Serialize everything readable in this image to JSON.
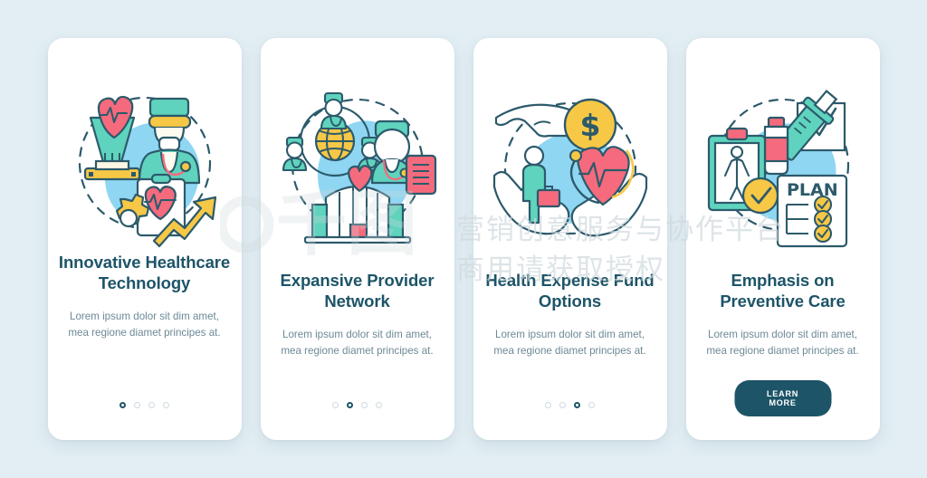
{
  "page": {
    "background_color": "#e2eef3",
    "card_color": "#ffffff",
    "accent_dark": "#1d5468",
    "accent_teal": "#5fd3bd",
    "accent_pink": "#f56a7d",
    "accent_yellow": "#f7c846",
    "accent_blue": "#8fd6f2",
    "muted_text": "#6c8996"
  },
  "screens": [
    {
      "id": "innovative-healthcare-technology",
      "illustration_name": "healthcare-technology-illustration",
      "title": "Innovative Healthcare Technology",
      "subtitle": "Lorem ipsum dolor sit dim amet, mea regione diamet principes at.",
      "pagination": {
        "total": 4,
        "active": 1
      },
      "cta": null
    },
    {
      "id": "expansive-provider-network",
      "illustration_name": "provider-network-illustration",
      "title": "Expansive Provider Network",
      "subtitle": "Lorem ipsum dolor sit dim amet, mea regione diamet principes at.",
      "pagination": {
        "total": 4,
        "active": 2
      },
      "cta": null
    },
    {
      "id": "health-expense-fund-options",
      "illustration_name": "health-expense-fund-illustration",
      "title": "Health Expense Fund Options",
      "subtitle": "Lorem ipsum dolor sit dim amet, mea regione diamet principes at.",
      "pagination": {
        "total": 4,
        "active": 3
      },
      "cta": null
    },
    {
      "id": "emphasis-on-preventive-care",
      "illustration_name": "preventive-care-illustration",
      "title": "Emphasis on Preventive Care",
      "subtitle": "Lorem ipsum dolor sit dim amet, mea regione diamet principes at.",
      "pagination": null,
      "cta": {
        "label": "LEARN MORE"
      }
    }
  ],
  "illustration_labels": {
    "plan_clipboard": "PLAN"
  },
  "watermark": {
    "logo_text": "千图",
    "line1": "营销创意服务与协作平台",
    "line2": "商用请获取授权"
  }
}
